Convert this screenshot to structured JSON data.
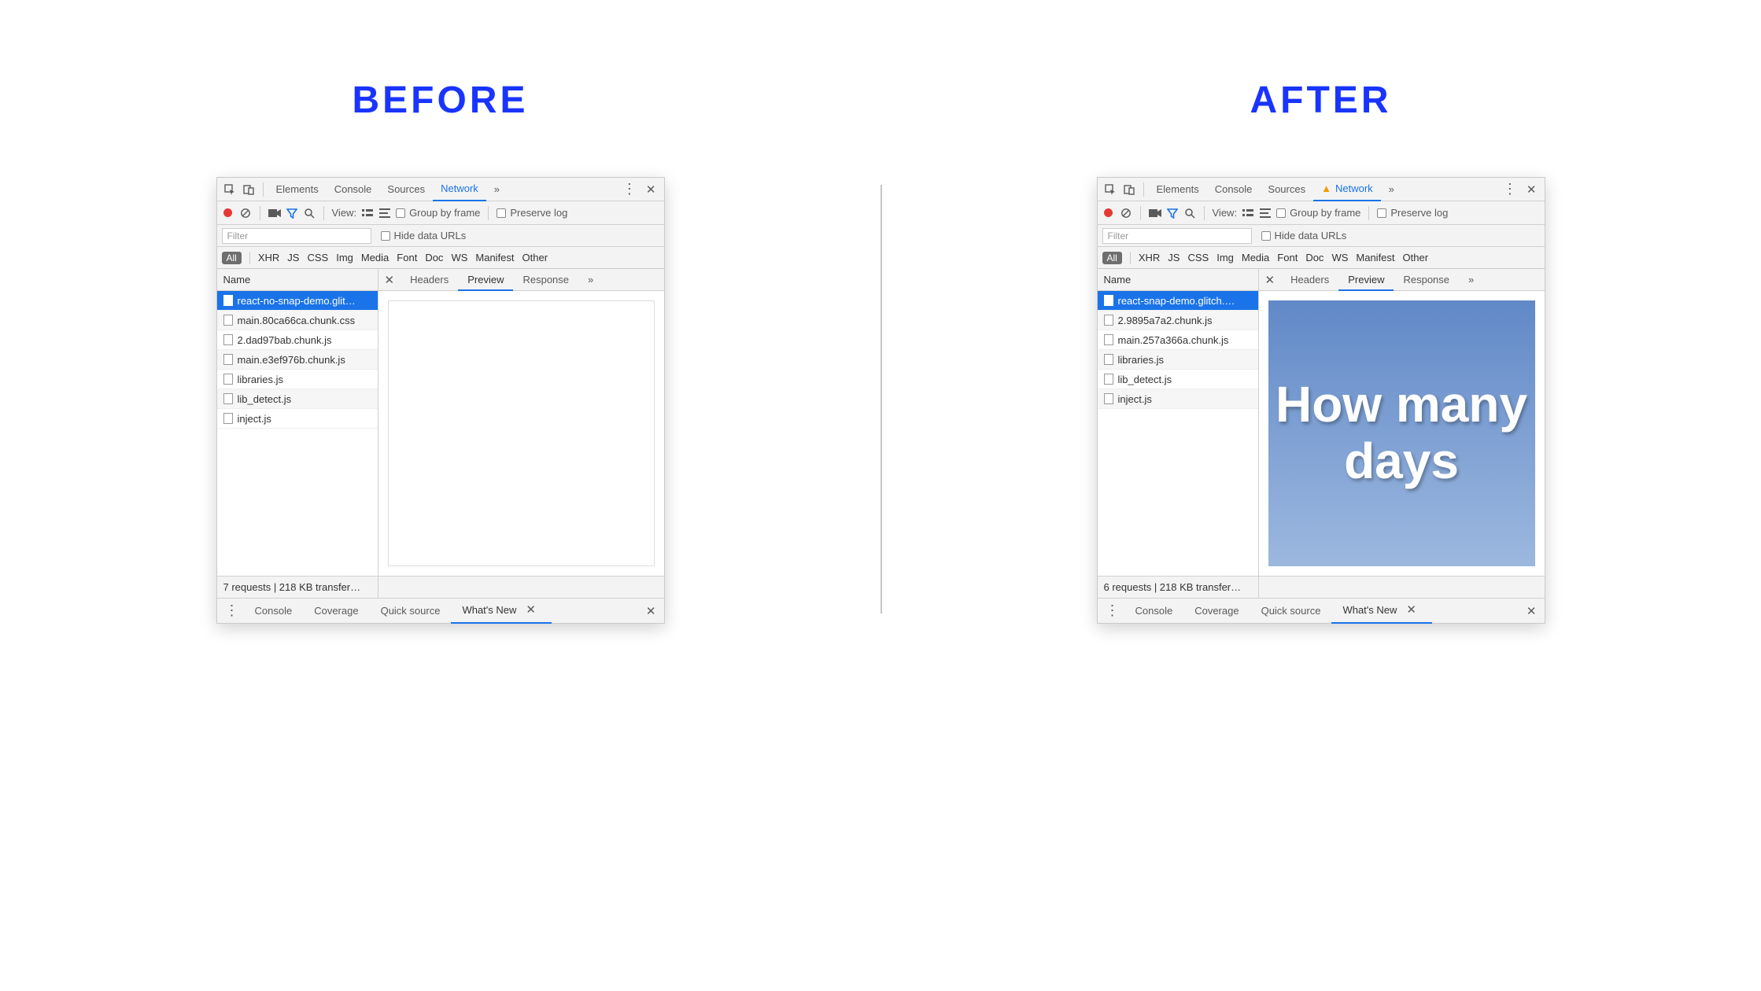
{
  "titles": {
    "before": "BEFORE",
    "after": "AFTER"
  },
  "top_tabs": {
    "elements": "Elements",
    "console": "Console",
    "sources": "Sources",
    "network": "Network"
  },
  "toolbar": {
    "view": "View:",
    "group_by_frame": "Group by frame",
    "preserve_log": "Preserve log"
  },
  "filter": {
    "placeholder": "Filter",
    "hide_data_urls": "Hide data URLs"
  },
  "types": {
    "all": "All",
    "list": [
      "XHR",
      "JS",
      "CSS",
      "Img",
      "Media",
      "Font",
      "Doc",
      "WS",
      "Manifest",
      "Other"
    ]
  },
  "columns": {
    "name": "Name"
  },
  "detail_tabs": {
    "headers": "Headers",
    "preview": "Preview",
    "response": "Response"
  },
  "drawer": {
    "console": "Console",
    "coverage": "Coverage",
    "quick_source": "Quick source",
    "whats_new": "What's New"
  },
  "before": {
    "requests": [
      "react-no-snap-demo.glit…",
      "main.80ca66ca.chunk.css",
      "2.dad97bab.chunk.js",
      "main.e3ef976b.chunk.js",
      "libraries.js",
      "lib_detect.js",
      "inject.js"
    ],
    "summary": "7 requests | 218 KB transfer…",
    "preview_text": ""
  },
  "after": {
    "requests": [
      "react-snap-demo.glitch.…",
      "2.9895a7a2.chunk.js",
      "main.257a366a.chunk.js",
      "libraries.js",
      "lib_detect.js",
      "inject.js"
    ],
    "summary": "6 requests | 218 KB transfer…",
    "preview_text": "How many days"
  }
}
